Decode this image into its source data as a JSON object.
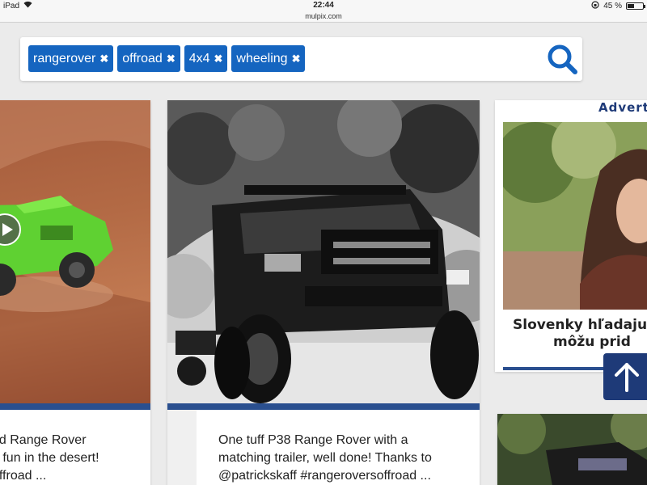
{
  "status_bar": {
    "device": "iPad",
    "time": "22:44",
    "battery": "45 %",
    "battery_level": 0.45
  },
  "browser": {
    "url": "mulpix.com"
  },
  "search": {
    "tags": [
      {
        "label": "rangerover"
      },
      {
        "label": "offroad"
      },
      {
        "label": "4x4"
      },
      {
        "label": "wheeling"
      }
    ],
    "remove_symbol": "✖"
  },
  "posts": [
    {
      "caption_lines": [
        "ed Range Rover",
        "e fun in the desert!",
        "offroad ..."
      ]
    },
    {
      "caption_lines": [
        "One tuff P38 Range Rover with a",
        "matching trailer, well done! Thanks to",
        "@patrickskaff #rangeroversoffroad ..."
      ]
    }
  ],
  "ad": {
    "label": "Advert",
    "title_lines": [
      "Slovenky hľadaju",
      "môžu prid"
    ]
  },
  "colors": {
    "accent": "#1565c0",
    "navy": "#1e3a78",
    "bar": "#2a4f8f"
  }
}
